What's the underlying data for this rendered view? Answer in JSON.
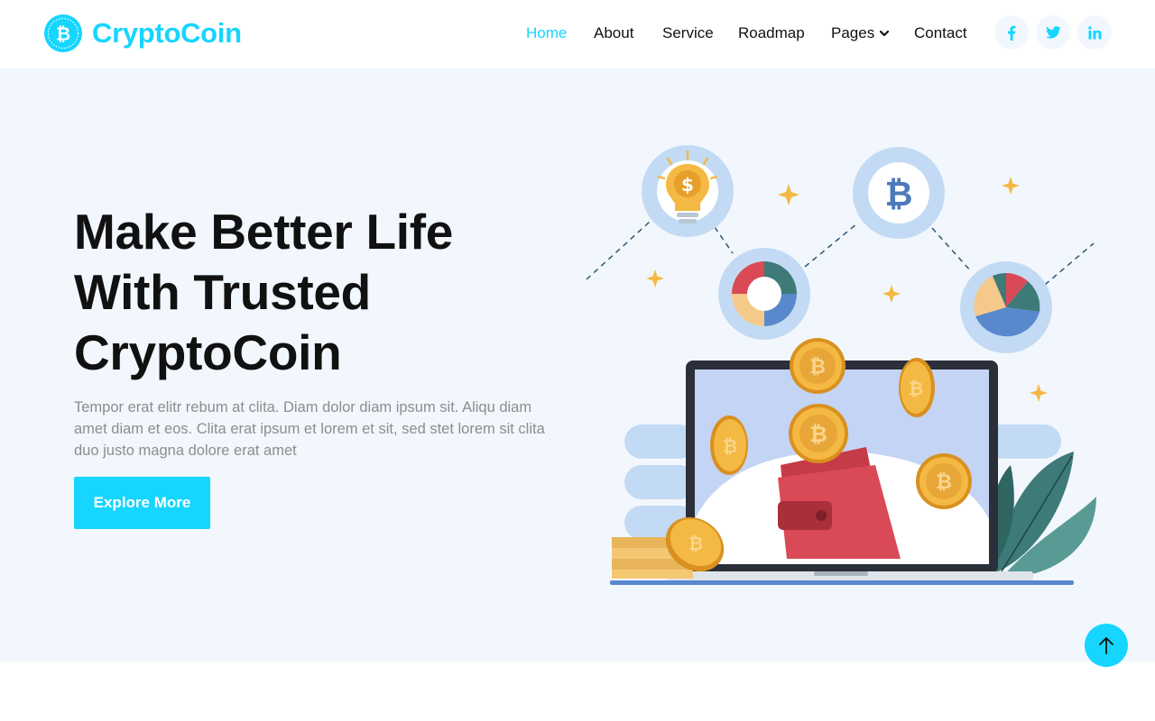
{
  "brand": {
    "name": "CryptoCoin",
    "logo_icon": "bitcoin-coin-icon"
  },
  "nav": {
    "items": [
      {
        "label": "Home",
        "active": true
      },
      {
        "label": "About",
        "active": false
      },
      {
        "label": "Service",
        "active": false
      },
      {
        "label": "Roadmap",
        "active": false
      },
      {
        "label": "Pages",
        "active": false,
        "dropdown": true
      },
      {
        "label": "Contact",
        "active": false
      }
    ],
    "social": [
      "facebook-icon",
      "twitter-icon",
      "linkedin-icon"
    ]
  },
  "hero": {
    "title_lines": [
      "Make Better Life",
      "With Trusted",
      "CryptoCoin"
    ],
    "text": "Tempor erat elitr rebum at clita. Diam dolor diam ipsum sit. Aliqu diam amet diam et eos. Clita erat ipsum et lorem et sit, sed stet lorem sit clita duo justo magna dolore erat amet",
    "button_label": "Explore More",
    "illustration_icon": "crypto-wallet-laptop-illustration"
  },
  "back_to_top_icon": "arrow-up-icon",
  "colors": {
    "accent": "#16d5ff",
    "hero_bg": "#f2f7fd",
    "text_dark": "#111111",
    "text_muted": "#8d8d8d",
    "social_icon": "#16d5ff"
  }
}
